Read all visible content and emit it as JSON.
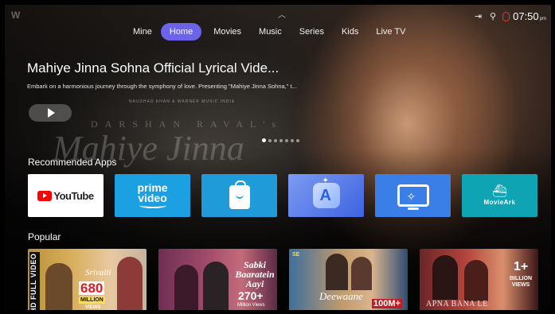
{
  "topbar": {
    "logo": "W",
    "status": {
      "icons": [
        "input-source-icon",
        "search-icon"
      ],
      "time": "07:50",
      "ampm": "pm"
    }
  },
  "nav": {
    "items": [
      {
        "label": "Mine",
        "active": false
      },
      {
        "label": "Home",
        "active": true
      },
      {
        "label": "Movies",
        "active": false
      },
      {
        "label": "Music",
        "active": false
      },
      {
        "label": "Series",
        "active": false
      },
      {
        "label": "Kids",
        "active": false
      },
      {
        "label": "Live TV",
        "active": false
      }
    ],
    "active_color": "#6b63ea"
  },
  "hero": {
    "title": "Mahiye Jinna Sohna Official Lyrical Vide...",
    "description": "Embark on a harmonious journey through the symphony of love. Presenting \"Mahiye Jinna Sohna,\" t...",
    "poster_presents": "NAUSHAD KHAN & WARNER MUSIC INDIA",
    "poster_artist": "DARSHAN RAVAL's",
    "poster_song": "Mahiye Jinna",
    "carousel": {
      "count": 7,
      "active_index": 0
    }
  },
  "recommended": {
    "title": "Recommended Apps",
    "apps": [
      {
        "name": "YouTube",
        "color": "#ffffff"
      },
      {
        "name": "prime video",
        "color": "#1ba0e2"
      },
      {
        "name": "App Store",
        "color": "#1e9bd8"
      },
      {
        "name": "AI App",
        "color": "#3d63e0"
      },
      {
        "name": "Cast",
        "color": "#3a7fe8"
      },
      {
        "name": "MovieArk",
        "color": "#0fa4b4"
      }
    ]
  },
  "popular": {
    "title": "Popular",
    "cards": [
      {
        "tag": "HD FULL VIDEO",
        "song": "Srivalli",
        "count": "680",
        "count_label": "MILLION",
        "views": "VIEWS"
      },
      {
        "title": "Sabki Baaratein Aayi",
        "count": "270+",
        "count_label": "Million Views"
      },
      {
        "logo": "SE",
        "title": "Deewaane",
        "count": "100M+"
      },
      {
        "count": "1+",
        "count_label": "BILLION VIEWS",
        "title": "APNA BANA LE"
      }
    ]
  }
}
